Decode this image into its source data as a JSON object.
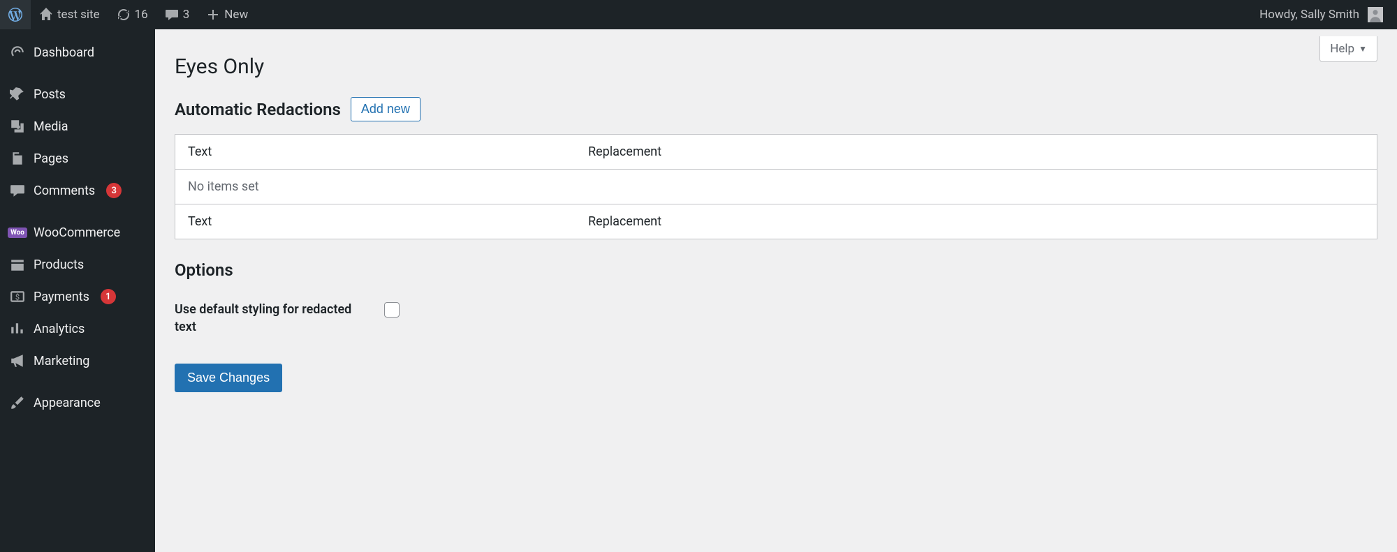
{
  "adminbar": {
    "site_name": "test site",
    "updates_count": "16",
    "comments_count": "3",
    "new_label": "New",
    "howdy": "Howdy, Sally Smith"
  },
  "sidebar": {
    "items": [
      {
        "label": "Dashboard"
      },
      {
        "label": "Posts"
      },
      {
        "label": "Media"
      },
      {
        "label": "Pages"
      },
      {
        "label": "Comments",
        "badge": "3"
      },
      {
        "label": "WooCommerce"
      },
      {
        "label": "Products"
      },
      {
        "label": "Payments",
        "badge": "1"
      },
      {
        "label": "Analytics"
      },
      {
        "label": "Marketing"
      },
      {
        "label": "Appearance"
      }
    ]
  },
  "help_label": "Help",
  "page": {
    "title": "Eyes Only",
    "redactions_heading": "Automatic Redactions",
    "add_new_label": "Add new",
    "table_col_text": "Text",
    "table_col_replacement": "Replacement",
    "no_items": "No items set",
    "options_heading": "Options",
    "default_styling_label": "Use default styling for redacted text",
    "save_label": "Save Changes"
  }
}
